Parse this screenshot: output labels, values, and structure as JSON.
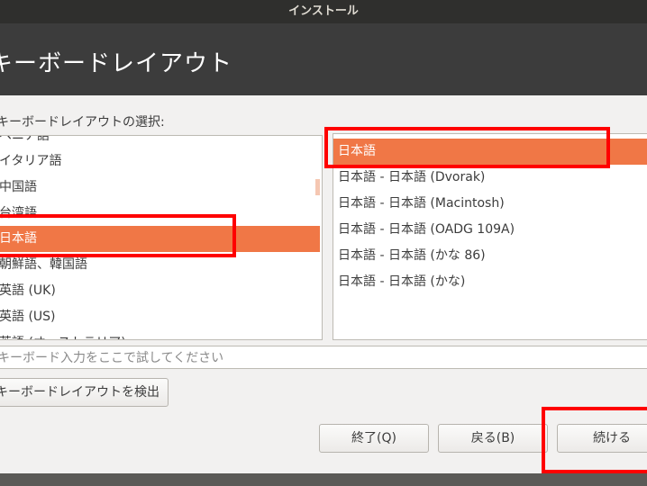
{
  "window": {
    "title": "インストール"
  },
  "header": {
    "title": "キーボードレイアウト"
  },
  "layout_section": {
    "label": "キーボードレイアウトの選択:"
  },
  "left_list": {
    "items": [
      {
        "label": "ベニア語",
        "selected": false
      },
      {
        "label": "イタリア語",
        "selected": false
      },
      {
        "label": "中国語",
        "selected": false
      },
      {
        "label": "台湾語",
        "selected": false
      },
      {
        "label": "日本語",
        "selected": true
      },
      {
        "label": "朝鮮語、韓国語",
        "selected": false
      },
      {
        "label": "英語 (UK)",
        "selected": false
      },
      {
        "label": "英語 (US)",
        "selected": false
      },
      {
        "label": "英語 (オーストラリア)",
        "selected": false
      }
    ]
  },
  "right_list": {
    "items": [
      {
        "label": "日本語",
        "selected": true
      },
      {
        "label": "日本語 - 日本語 (Dvorak)",
        "selected": false
      },
      {
        "label": "日本語 - 日本語 (Macintosh)",
        "selected": false
      },
      {
        "label": "日本語 - 日本語 (OADG 109A)",
        "selected": false
      },
      {
        "label": "日本語 - 日本語 (かな 86)",
        "selected": false
      },
      {
        "label": "日本語 - 日本語 (かな)",
        "selected": false
      }
    ]
  },
  "test_field": {
    "placeholder": "キーボード入力をここで試してください"
  },
  "detect_button": {
    "label": "キーボードレイアウトを検出"
  },
  "nav": {
    "quit_label": "終了(Q)",
    "back_label": "戻る(B)",
    "continue_label": "続ける"
  },
  "colors": {
    "accent": "#f07746",
    "highlight": "#ff0000",
    "header_bg": "#3c3c3c"
  }
}
